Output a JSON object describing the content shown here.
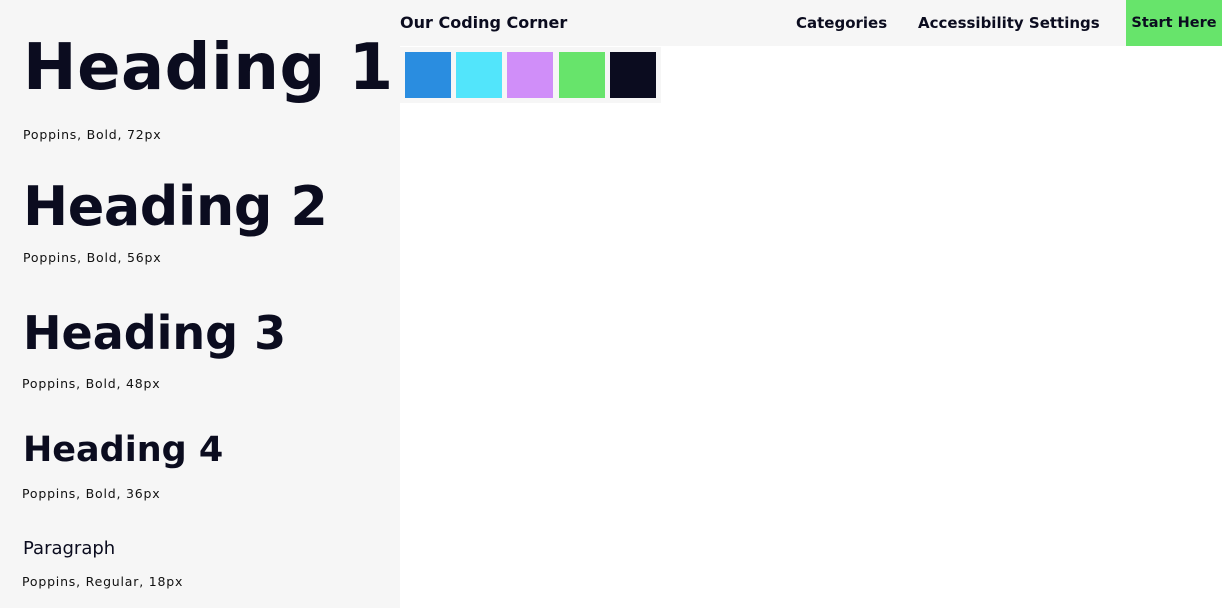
{
  "typography": [
    {
      "sample": "Heading 1",
      "spec": "Poppins, Bold, 72px"
    },
    {
      "sample": "Heading 2",
      "spec": "Poppins, Bold, 56px"
    },
    {
      "sample": "Heading 3",
      "spec": "Poppins, Bold, 48px"
    },
    {
      "sample": "Heading 4",
      "spec": "Poppins, Bold, 36px"
    },
    {
      "sample": "Paragraph",
      "spec": "Poppins, Regular, 18px"
    }
  ],
  "nav": {
    "brand": "Our Coding Corner",
    "links": [
      "Categories",
      "Accessibility Settings"
    ],
    "cta": "Start Here",
    "cta_color": "#67e46b"
  },
  "palette": [
    "#2a8de0",
    "#52e5fb",
    "#d08ef9",
    "#67e46b",
    "#0b0c1f"
  ]
}
